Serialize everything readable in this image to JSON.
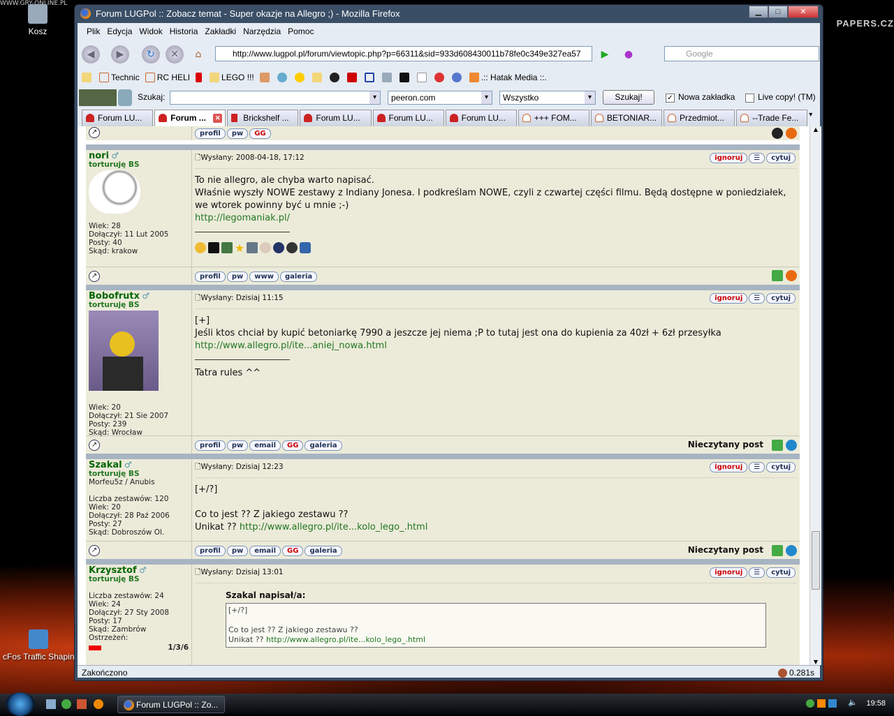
{
  "desktop": {
    "recycle_label": "Kosz",
    "cfos_label": "cFos Traffic Shapin",
    "watermark": "PAPERS.CZ",
    "watermark_top": "WWW.GRY-ONLINE.PL"
  },
  "window": {
    "title": "Forum LUGPol :: Zobacz temat - Super okazje na Allegro ;) - Mozilla Firefox",
    "min": "▁",
    "max": "□",
    "close": "✕"
  },
  "menu": [
    "Plik",
    "Edycja",
    "Widok",
    "Historia",
    "Zakładki",
    "Narzędzia",
    "Pomoc"
  ],
  "nav": {
    "url": "http://www.lugpol.pl/forum/viewtopic.php?p=66311&sid=933d608430011b78fe0c349e327ea57",
    "search_placeholder": "Google"
  },
  "bookmarks": [
    "Technic",
    "RC HELI",
    "LEGO !!!",
    ".:: Hatak Media ::."
  ],
  "searchbar": {
    "label": "Szukaj:",
    "value": "",
    "site": "peeron.com",
    "scope": "Wszystko",
    "button": "Szukaj!",
    "new_tab": "Nowa zakładka",
    "live_copy": "Live copy! (TM)",
    "new_tab_checked": true,
    "live_copy_checked": false
  },
  "tabs": [
    "Forum LU...",
    "Forum ...",
    "Brickshelf ...",
    "Forum LU...",
    "Forum LU...",
    "Forum LU...",
    "+++ FOM...",
    "BETONIAR...",
    "Przedmiot...",
    "--Trade Fe..."
  ],
  "buttons": {
    "profil": "profil",
    "pw": "pw",
    "www": "www",
    "galeria": "galeria",
    "email": "email",
    "gg": "GG",
    "ignoruj": "ignoruj",
    "cytuj": "cytuj",
    "unread": "Nieczytany post"
  },
  "posts": [
    {
      "name": "nori",
      "rank": "torturuję BS",
      "info": [
        "Wiek: 28",
        "Dołączył: 11 Lut 2005",
        "Posty: 40",
        "Skąd: krakow"
      ],
      "date": "Wysłany: 2008-04-18, 17:12",
      "lines": [
        "To nie allegro, ale chyba warto napisać.",
        "Właśnie wyszły NOWE zestawy z Indiany Jonesa. I podkreślam NOWE, czyli z czwartej części filmu. Będą dostępne w poniedziałek, we wtorek powinny być u mnie ;-)"
      ],
      "link": "http://legomaniak.pl/"
    },
    {
      "name": "Bobofrutx",
      "rank": "torturuję BS",
      "info": [
        "Wiek: 20",
        "Dołączył: 21 Sie 2007",
        "Posty: 239",
        "Skąd: Wrocław"
      ],
      "date": "Wysłany: Dzisiaj 11:15",
      "lines": [
        "[+]",
        "Jeśli ktos chciał by kupić betoniarkę 7990 a jeszcze jej niema ;P to tutaj jest ona do kupienia za 40zł + 6zł przesyłka"
      ],
      "link": "http://www.allegro.pl/ite...aniej_nowa.html",
      "sig": "Tatra rules ^^"
    },
    {
      "name": "Szakal",
      "rank": "torturuję BS",
      "sub": "Morfeu5z / Anubis",
      "info": [
        "Liczba zestawów: 120",
        "Wiek: 20",
        "Dołączył: 28 Paź 2006",
        "Posty: 27",
        "Skąd: Dobroszów Ol."
      ],
      "date": "Wysłany: Dzisiaj 12:23",
      "lines": [
        "[+/?]",
        "",
        "Co to jest ?? Z jakiego zestawu ??"
      ],
      "unikat": "Unikat ??",
      "link": "http://www.allegro.pl/ite...kolo_lego_.html"
    },
    {
      "name": "Krzysztof",
      "rank": "torturuję BS",
      "info": [
        "Liczba zestawów: 24",
        "Wiek: 24",
        "Dołączył: 27 Sty 2008",
        "Posty: 17",
        "Skąd: Zambrów",
        "Ostrzeżeń:"
      ],
      "warn": "1/3/6",
      "date": "Wysłany: Dzisiaj 13:01",
      "quote_author": "Szakal napisał/a:",
      "quote_lines": [
        "[+/?]",
        "",
        "Co to jest ?? Z jakiego zestawu ??"
      ],
      "quote_unikat": "Unikat ??",
      "quote_link": "http://www.allegro.pl/ite...kolo_lego_.html"
    }
  ],
  "status": {
    "text": "Zakończono",
    "time": "0.281s"
  },
  "taskbar": {
    "task": "Forum LUGPol :: Zo...",
    "clock": "19:58"
  }
}
